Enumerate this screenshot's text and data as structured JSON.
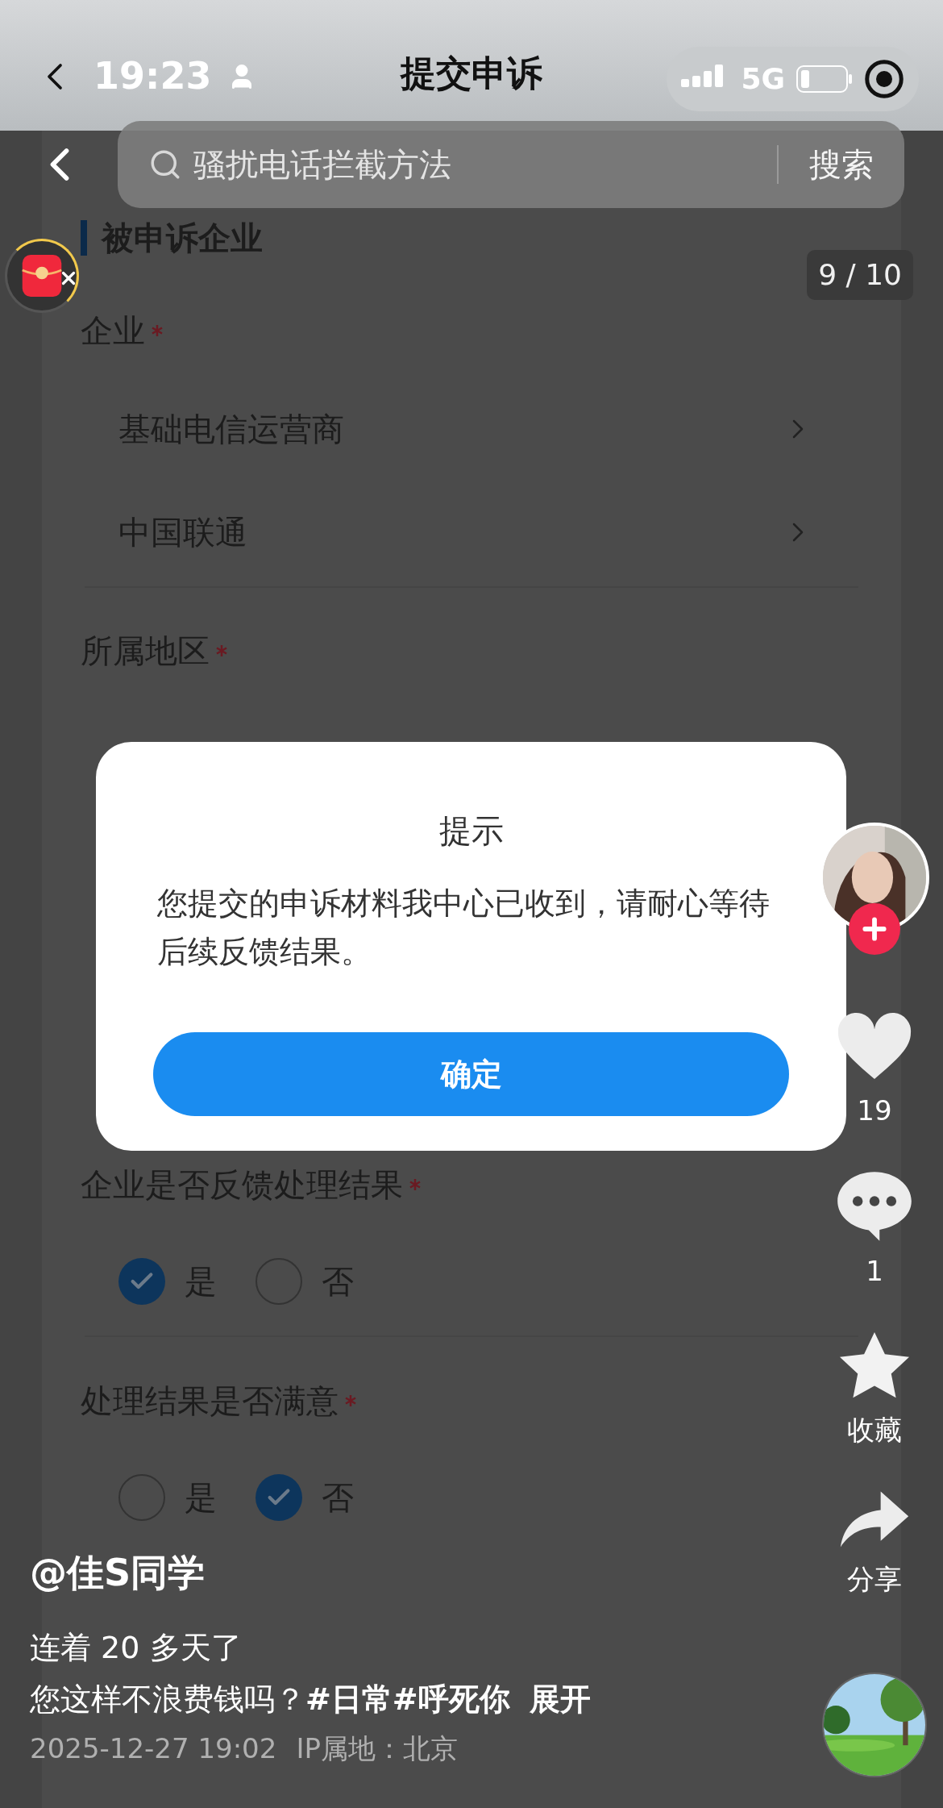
{
  "status_bar": {
    "time": "19:23",
    "network": "5G"
  },
  "nav": {
    "title": "提交申诉"
  },
  "search": {
    "placeholder": "骚扰电话拦截方法",
    "button": "搜索"
  },
  "page_counter": "9 / 10",
  "form": [
    {
      "kind": "section",
      "text": "被申诉企业"
    },
    {
      "kind": "label",
      "text": "企业",
      "required": true
    },
    {
      "kind": "select",
      "text": "基础电信运营商"
    },
    {
      "kind": "select",
      "text": "中国联通"
    },
    {
      "kind": "divider"
    },
    {
      "kind": "label",
      "text": "所属地区",
      "required": true
    },
    {
      "kind": "label",
      "text": "企业是否反馈处理结果",
      "required": true
    },
    {
      "kind": "radio",
      "options": [
        {
          "label": "是",
          "selected": true
        },
        {
          "label": "否",
          "selected": false
        }
      ]
    },
    {
      "kind": "divider"
    },
    {
      "kind": "label",
      "text": "处理结果是否满意",
      "required": true
    },
    {
      "kind": "radio",
      "options": [
        {
          "label": "是",
          "selected": false
        },
        {
          "label": "否",
          "selected": true
        }
      ]
    }
  ],
  "dialog": {
    "title": "提示",
    "message": "您提交的申诉材料我中心已收到，请耐心等待后续反馈结果。",
    "button": "确定"
  },
  "actions": [
    {
      "kind": "like",
      "label": "19"
    },
    {
      "kind": "comment",
      "label": "1"
    },
    {
      "kind": "favorite",
      "label": "收藏"
    },
    {
      "kind": "share",
      "label": "分享"
    }
  ],
  "post": {
    "author": "@佳S同学",
    "lines": [
      "连着 20 多天了"
    ],
    "text": "您这样不浪费钱吗？",
    "hashtags": [
      "#日常",
      "#呼死你"
    ],
    "expand": "展开",
    "date": "2025-12-27 19:02",
    "location": "IP属地：北京"
  }
}
